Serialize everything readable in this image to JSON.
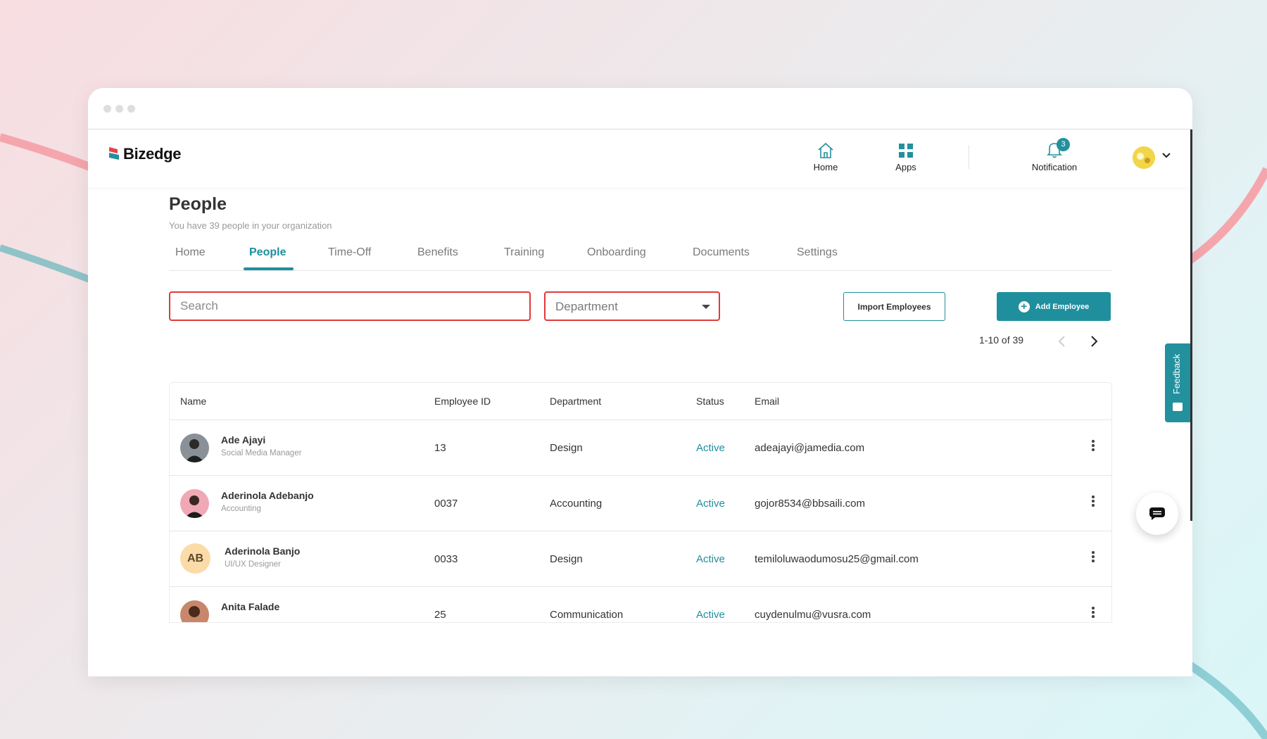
{
  "app": {
    "brand": "Bizedge",
    "nav": {
      "home": "Home",
      "apps": "Apps",
      "notification": "Notification",
      "notification_count": "3"
    }
  },
  "page": {
    "title": "People",
    "subtitle": "You have 39 people in your organization",
    "tabs": [
      "Home",
      "People",
      "Time-Off",
      "Benefits",
      "Training",
      "Onboarding",
      "Documents",
      "Settings"
    ],
    "active_tab": "People"
  },
  "toolbar": {
    "search_placeholder": "Search",
    "department_label": "Department",
    "import_label": "Import Employees",
    "add_label": "Add Employee"
  },
  "pagination": {
    "text": "1-10 of 39"
  },
  "table": {
    "columns": [
      "Name",
      "Employee ID",
      "Department",
      "Status",
      "Email"
    ],
    "rows": [
      {
        "name": "Ade Ajayi",
        "role": "Social Media Manager",
        "id": "13",
        "department": "Design",
        "status": "Active",
        "email": "adeajayi@jamedia.com",
        "avatar": "photo"
      },
      {
        "name": "Aderinola Adebanjo",
        "role": "Accounting",
        "id": "0037",
        "department": "Accounting",
        "status": "Active",
        "email": "gojor8534@bbsaili.com",
        "avatar": "photo"
      },
      {
        "name": "Aderinola Banjo",
        "role": "UI/UX Designer",
        "id": "0033",
        "department": "Design",
        "status": "Active",
        "email": "temiloluwaodumosu25@gmail.com",
        "avatar": "AB"
      },
      {
        "name": "Anita Falade",
        "role": "",
        "id": "25",
        "department": "Communication",
        "status": "Active",
        "email": "cuydenulmu@vusra.com",
        "avatar": "photo"
      }
    ]
  },
  "feedback": {
    "label": "Feedback"
  },
  "colors": {
    "accent": "#1f8f9e",
    "highlight": "#e03a3a"
  }
}
